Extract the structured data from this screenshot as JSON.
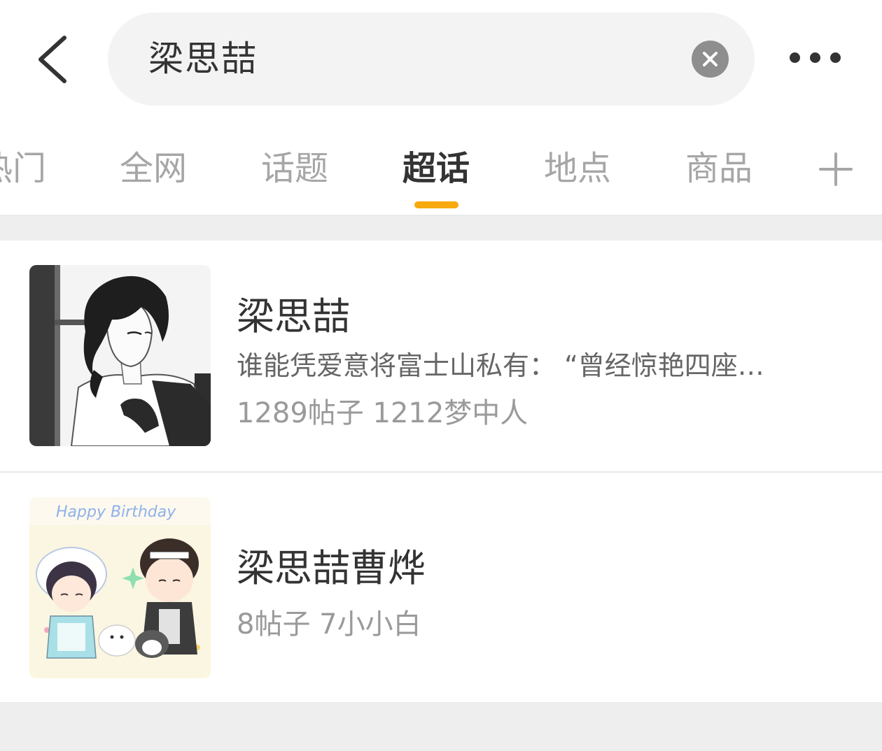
{
  "search": {
    "query": "梁思喆"
  },
  "tabs": [
    {
      "label": "热门",
      "active": false
    },
    {
      "label": "全网",
      "active": false
    },
    {
      "label": "话题",
      "active": false
    },
    {
      "label": "超话",
      "active": true
    },
    {
      "label": "地点",
      "active": false
    },
    {
      "label": "商品",
      "active": false
    }
  ],
  "results": [
    {
      "title": "梁思喆",
      "description": "谁能凭爱意将富士山私有：  “曾经惊艳四座…",
      "meta": "1289帖子 1212梦中人"
    },
    {
      "title": "梁思喆曹烨",
      "meta": "8帖子 7小小白"
    }
  ],
  "thumbnail_text": {
    "birthday": "Happy Birthday"
  },
  "colors": {
    "accent": "#f7a90e",
    "text_primary": "#333333",
    "text_secondary": "#666666",
    "text_muted": "#9a9a9a",
    "tab_inactive": "#a6a6a6",
    "search_bg": "#f3f3f3",
    "page_bg": "#eeeeee"
  },
  "icons": {
    "back": "chevron-left-icon",
    "clear": "clear-circle-icon",
    "more": "more-dots-icon",
    "add_tab": "plus-icon"
  }
}
